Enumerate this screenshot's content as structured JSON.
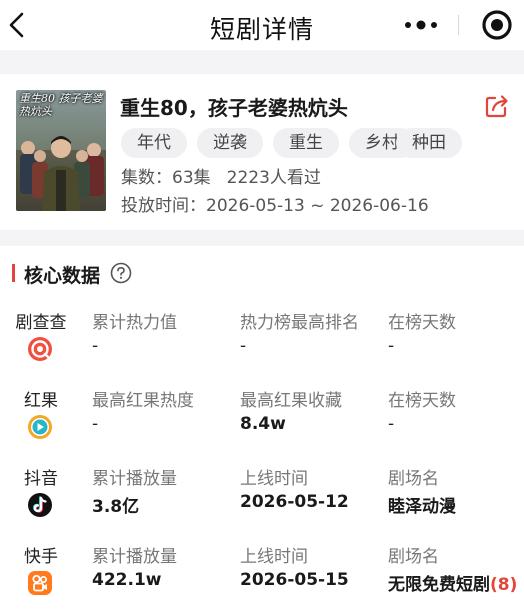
{
  "nav": {
    "title": "短剧详情",
    "back_icon": "chevron-left-icon",
    "more_icon": "more-dots-icon",
    "record_icon": "record-circle-icon"
  },
  "drama": {
    "poster_text": "重生80 孩子老婆热炕头",
    "title": "重生80，孩子老婆热炕头",
    "tags": [
      "年代",
      "逆袭",
      "重生",
      "乡村",
      "种田"
    ],
    "episodes_label": "集数：",
    "episodes_value": "63集",
    "viewers": "2223人看过",
    "release_label": "投放时间：",
    "release_value": "2026-05-13 ~ 2026-06-16",
    "share_icon": "share-icon"
  },
  "core_data": {
    "title": "核心数据",
    "help_icon": "question-circle-icon",
    "accent_color": "#e2463a",
    "platforms": [
      {
        "name": "剧查查",
        "logo_icon": "juchacha-logo-icon",
        "columns": [
          {
            "label": "累计热力值",
            "value": "-"
          },
          {
            "label": "热力榜最高排名",
            "value": "-"
          },
          {
            "label": "在榜天数",
            "value": "-"
          }
        ]
      },
      {
        "name": "红果",
        "logo_icon": "hongguo-logo-icon",
        "columns": [
          {
            "label": "最高红果热度",
            "value": "-"
          },
          {
            "label": "最高红果收藏",
            "value": "8.4w"
          },
          {
            "label": "在榜天数",
            "value": "-"
          }
        ]
      },
      {
        "name": "抖音",
        "logo_icon": "douyin-logo-icon",
        "columns": [
          {
            "label": "累计播放量",
            "value": "3.8亿"
          },
          {
            "label": "上线时间",
            "value": "2026-05-12"
          },
          {
            "label": "剧场名",
            "value": "睦泽动漫"
          }
        ]
      },
      {
        "name": "快手",
        "logo_icon": "kuaishou-logo-icon",
        "columns": [
          {
            "label": "累计播放量",
            "value": "422.1w"
          },
          {
            "label": "上线时间",
            "value": "2026-05-15"
          },
          {
            "label": "剧场名",
            "value": "无限免费短剧",
            "count": "(8)"
          }
        ]
      }
    ]
  }
}
